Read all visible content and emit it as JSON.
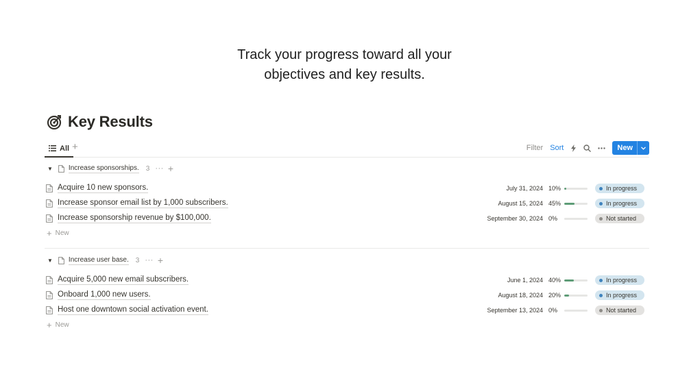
{
  "headline": {
    "line1": "Track your progress toward all your",
    "line2": "objectives and key results."
  },
  "database": {
    "title": "Key Results",
    "icon": "target-icon"
  },
  "viewbar": {
    "tab_label": "All",
    "filter_label": "Filter",
    "sort_label": "Sort",
    "new_label": "New",
    "accent_color": "#2383e2"
  },
  "groups": [
    {
      "name": "Increase sponsorships.",
      "count": "3",
      "add_label": "New",
      "rows": [
        {
          "title": "Acquire 10 new sponsors.",
          "date": "July 31, 2024",
          "progress_label": "10%",
          "progress": 0.1,
          "status": "In progress"
        },
        {
          "title": "Increase sponsor email list by 1,000 subscribers.",
          "date": "August 15, 2024",
          "progress_label": "45%",
          "progress": 0.45,
          "status": "In progress"
        },
        {
          "title": "Increase sponsorship revenue by $100,000.",
          "date": "September 30, 2024",
          "progress_label": "0%",
          "progress": 0.0,
          "status": "Not started"
        }
      ]
    },
    {
      "name": "Increase user base.",
      "count": "3",
      "add_label": "New",
      "rows": [
        {
          "title": "Acquire 5,000 new email subscribers.",
          "date": "June 1, 2024",
          "progress_label": "40%",
          "progress": 0.4,
          "status": "In progress"
        },
        {
          "title": "Onboard 1,000 new users.",
          "date": "August 18, 2024",
          "progress_label": "20%",
          "progress": 0.2,
          "status": "In progress"
        },
        {
          "title": "Host one downtown social activation event.",
          "date": "September 13, 2024",
          "progress_label": "0%",
          "progress": 0.0,
          "status": "Not started"
        }
      ]
    }
  ],
  "status_colors": {
    "In progress": "#d3e5ef",
    "Not started": "#e3e2e0",
    "progress_fill": "#5e9c77"
  }
}
